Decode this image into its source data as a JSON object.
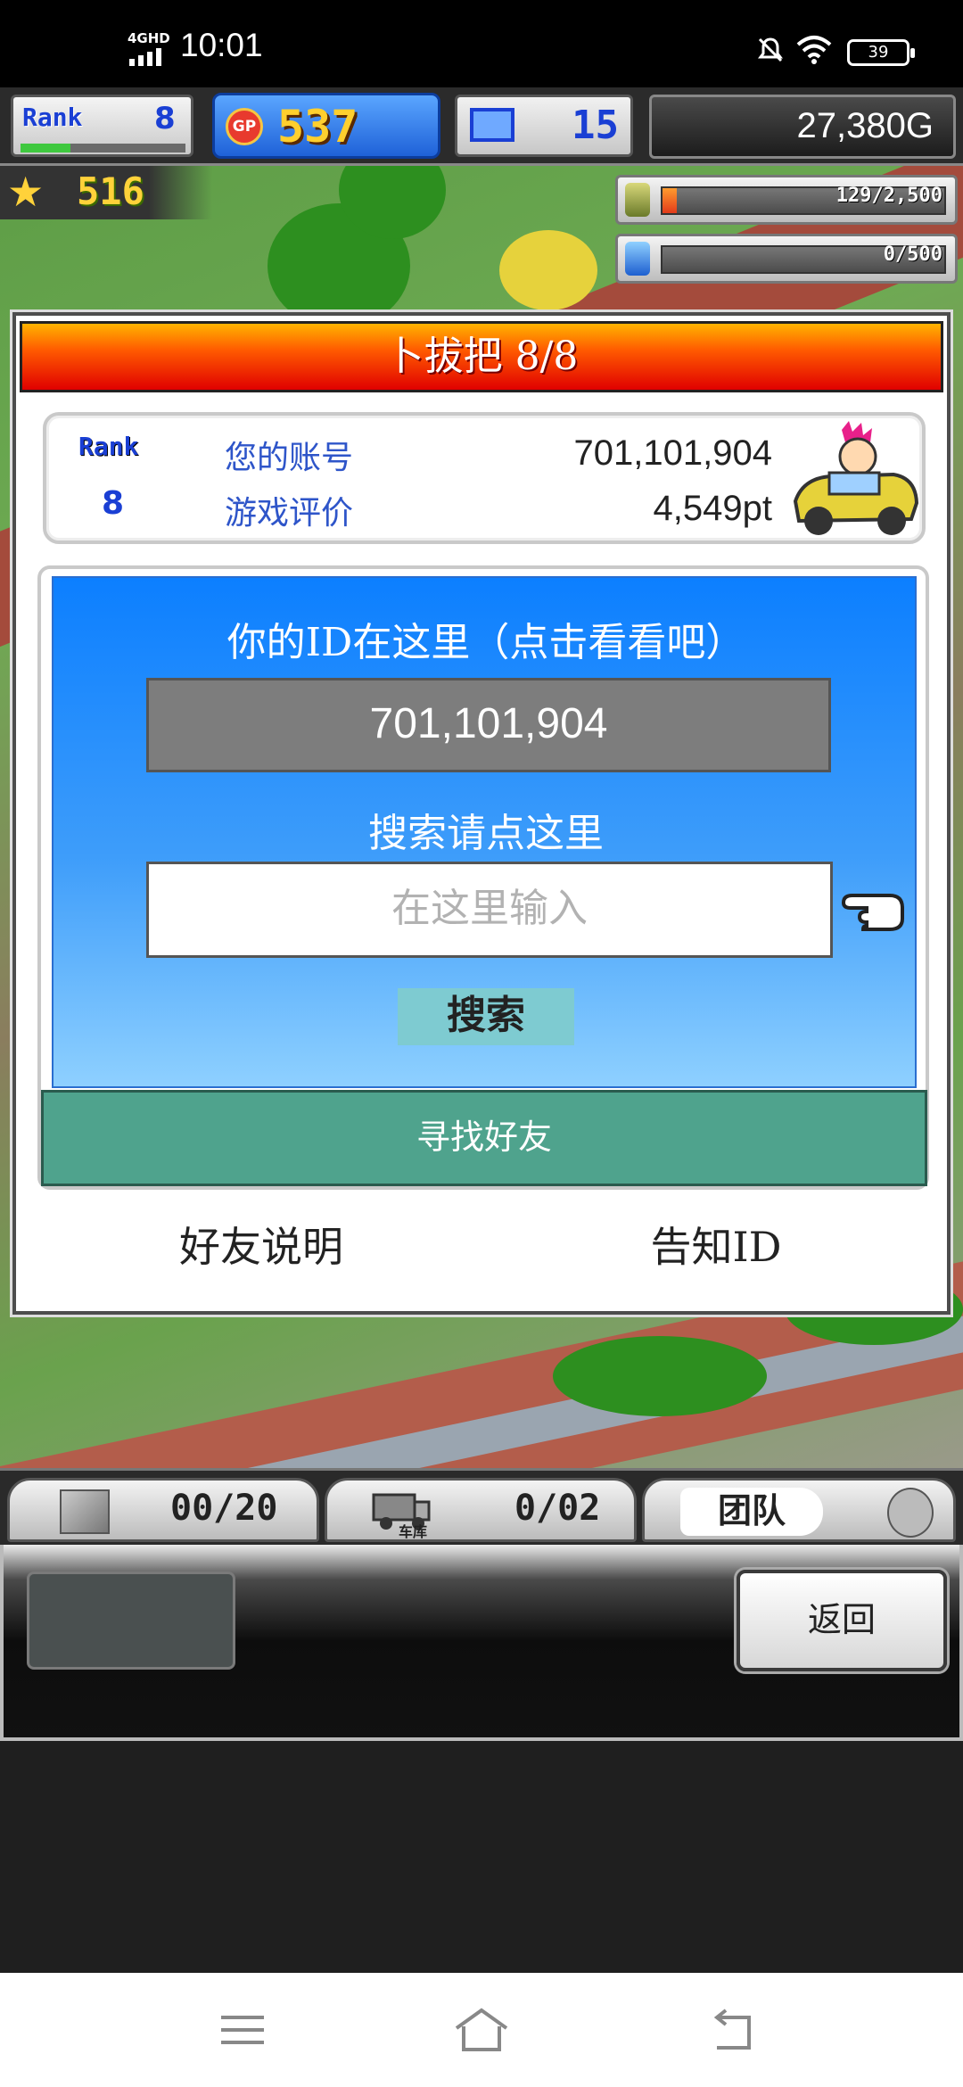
{
  "status_bar": {
    "network": "4GHD",
    "time": "10:01",
    "battery": "39"
  },
  "hud": {
    "rank_label": "Rank",
    "rank_value": "8",
    "rank_progress": 0.3,
    "gp_label": "GP",
    "gp_value": "537",
    "computers_value": "15",
    "gold": "27,380G",
    "stars": "516",
    "resource1": {
      "text": "129/2,500",
      "fill": 0.05
    },
    "resource2": {
      "text": "0/500",
      "fill": 0
    }
  },
  "dialog": {
    "title": "卜拔把 8/8",
    "account": {
      "rank_label": "Rank",
      "rank_value": "8",
      "id_label": "您的账号",
      "id_value": "701,101,904",
      "rating_label": "游戏评价",
      "rating_value": "4,549pt"
    },
    "your_id_heading": "你的ID在这里（点击看看吧）",
    "your_id_value": "701,101,904",
    "search_heading": "搜索请点这里",
    "search_placeholder": "在这里输入",
    "search_button": "搜索",
    "find_friends": "寻找好友",
    "friends_help": "好友说明",
    "share_id": "告知ID"
  },
  "bottom_bar": {
    "slot1": "00/20",
    "slot2_label": "车库",
    "slot2": "0/02",
    "team_label": "团队"
  },
  "dock": {
    "back_button": "返回"
  },
  "colors": {
    "accent_blue": "#0c7fff",
    "teal": "#4fa38d",
    "title_red": "#e00000",
    "gp_blue": "#1f62d8"
  }
}
